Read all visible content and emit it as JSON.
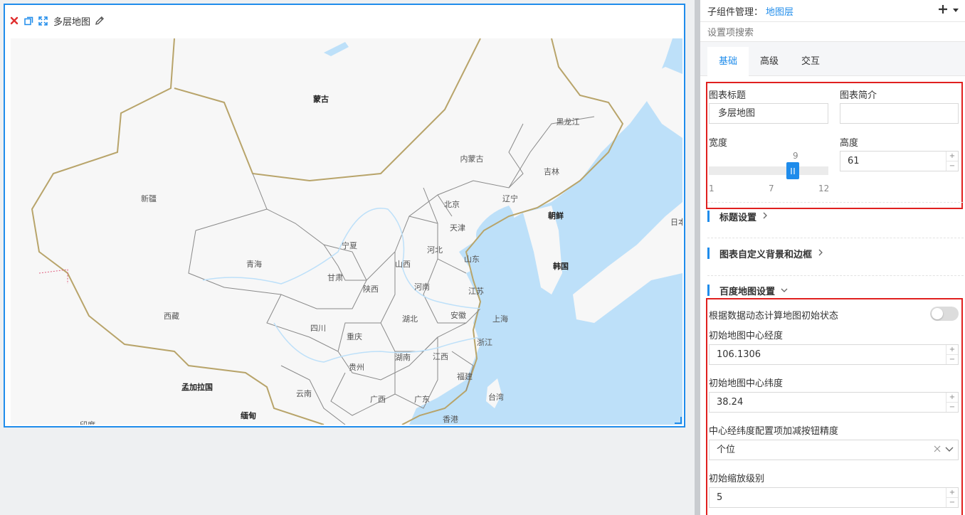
{
  "widget": {
    "title": "多层地图",
    "accent_color": "#1f8ceb",
    "toolbar_icons": [
      "close-icon",
      "copy-icon",
      "fullscreen-icon",
      "edit-pencil-icon"
    ]
  },
  "map": {
    "labels": {
      "mongolia": "蒙古",
      "heilongjiang": "黑龙江",
      "neimenggu": "内蒙古",
      "jilin": "吉林",
      "xinjiang": "新疆",
      "liaoning": "辽宁",
      "north_korea": "朝鲜",
      "japan": "日本",
      "beijing": "北京",
      "tianjin": "天津",
      "ningxia": "宁夏",
      "hebei": "河北",
      "shandong": "山东",
      "qinghai": "青海",
      "shanxi": "山西",
      "gansu": "甘肃",
      "south_korea": "韩国",
      "shaanxi": "陕西",
      "henan": "河南",
      "jiangsu": "江苏",
      "xizang": "西藏",
      "hubei": "湖北",
      "anhui": "安徽",
      "shanghai": "上海",
      "sichuan": "四川",
      "chongqing": "重庆",
      "zhejiang": "浙江",
      "hunan": "湖南",
      "jiangxi": "江西",
      "guizhou": "贵州",
      "fujian": "福建",
      "bangladesh": "孟加拉国",
      "yunnan": "云南",
      "guangxi": "广西",
      "guangdong": "广东",
      "taiwan": "台湾",
      "myanmar": "缅甸",
      "hongkong": "香港",
      "india": "印度"
    },
    "colors": {
      "land": "#f7f7f7",
      "water": "#bde0f9",
      "border_country": "#b8a46a",
      "border_province": "#8a8a8a"
    }
  },
  "panel": {
    "sub_component_label": "子组件管理：",
    "sub_component_value": "地图层",
    "search_placeholder": "设置项搜索",
    "tabs": [
      {
        "label": "基础",
        "active": true
      },
      {
        "label": "高级",
        "active": false
      },
      {
        "label": "交互",
        "active": false
      }
    ],
    "chart_title_label": "图表标题",
    "chart_title_value": "多层地图",
    "chart_desc_label": "图表简介",
    "chart_desc_value": "",
    "width_label": "宽度",
    "width_slider": {
      "value": "9",
      "min": "1",
      "mid": "7",
      "max": "12",
      "fraction": 0.69
    },
    "height_label": "高度",
    "height_value": "61",
    "sections": {
      "title_settings": "标题设置",
      "custom_bg": "图表自定义背景和边框",
      "baidu_map": "百度地图设置"
    },
    "dynamic_label": "根据数据动态计算地图初始状态",
    "dynamic_on": false,
    "center_lng_label": "初始地图中心经度",
    "center_lng_value": "106.1306",
    "center_lat_label": "初始地图中心纬度",
    "center_lat_value": "38.24",
    "precision_label": "中心经纬度配置项加减按钮精度",
    "precision_value": "个位",
    "zoom_label": "初始缩放级别",
    "zoom_value": "5",
    "highlight_color": "#e0201f"
  }
}
